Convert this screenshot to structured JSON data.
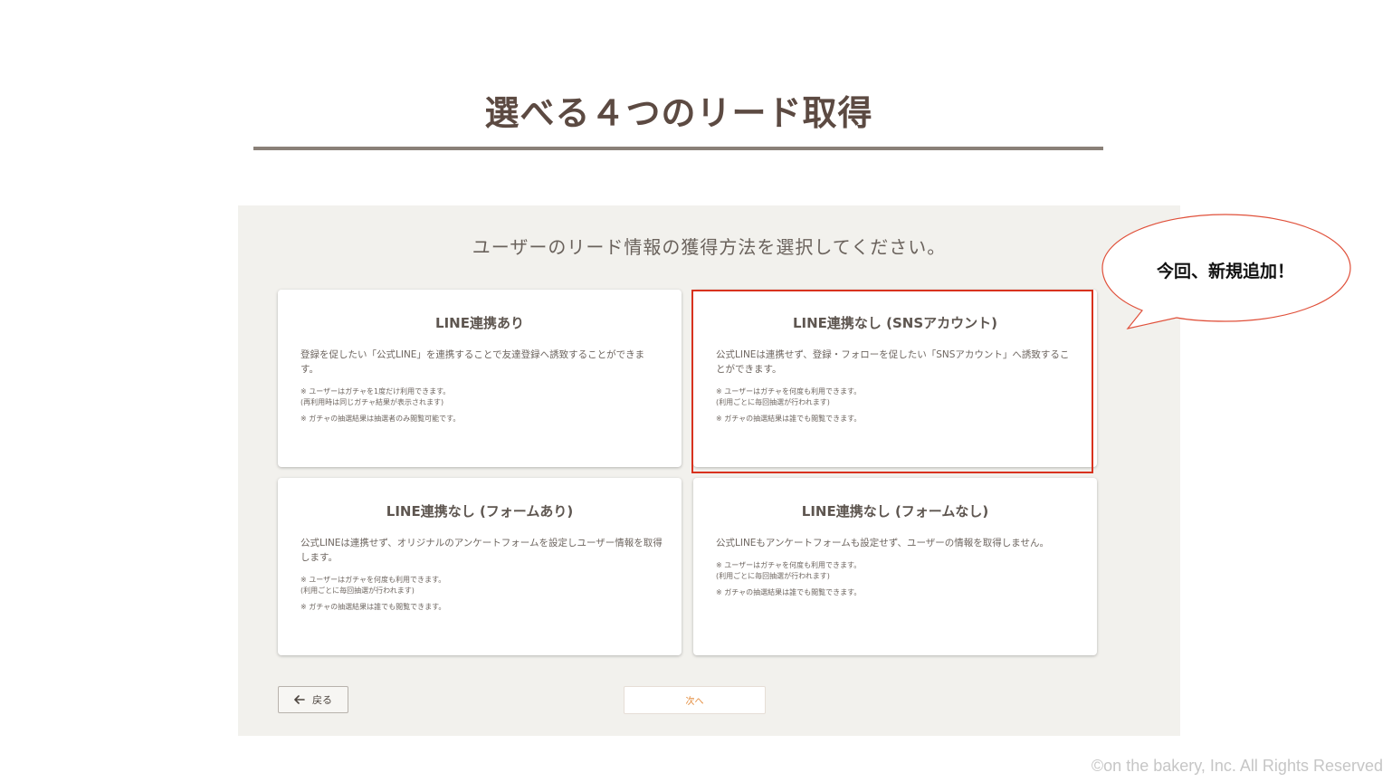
{
  "slide": {
    "title": "選べる４つのリード取得",
    "copyright": "©on the bakery, Inc. All Rights Reserved"
  },
  "panel": {
    "prompt": "ユーザーのリード情報の獲得方法を選択してください。",
    "cards": [
      {
        "title": "LINE連携あり",
        "description": "登録を促したい「公式LINE」を連携することで友達登録へ誘致することができます。",
        "notes": [
          "※ ユーザーはガチャを1度だけ利用できます。",
          "(再利用時は同じガチャ結果が表示されます)",
          "※ ガチャの抽選結果は抽選者のみ閲覧可能です。"
        ]
      },
      {
        "title": "LINE連携なし (SNSアカウント)",
        "description": "公式LINEは連携せず、登録・フォローを促したい「SNSアカウント」へ誘致することができます。",
        "notes": [
          "※ ユーザーはガチャを何度も利用できます。",
          "(利用ごとに毎回抽選が行われます)",
          "※ ガチャの抽選結果は誰でも閲覧できます。"
        ]
      },
      {
        "title": "LINE連携なし (フォームあり)",
        "description": "公式LINEは連携せず、オリジナルのアンケートフォームを設定しユーザー情報を取得します。",
        "notes": [
          "※ ユーザーはガチャを何度も利用できます。",
          "(利用ごとに毎回抽選が行われます)",
          "※ ガチャの抽選結果は誰でも閲覧できます。"
        ]
      },
      {
        "title": "LINE連携なし (フォームなし)",
        "description": "公式LINEもアンケートフォームも設定せず、ユーザーの情報を取得しません。",
        "notes": [
          "※ ユーザーはガチャを何度も利用できます。",
          "(利用ごとに毎回抽選が行われます)",
          "※ ガチャの抽選結果は誰でも閲覧できます。"
        ]
      }
    ],
    "back_label": "戻る",
    "next_label": "次へ"
  },
  "callout": {
    "text": "今回、新規追加！"
  },
  "colors": {
    "title": "#5c4a42",
    "panel_bg": "#f2f1ed",
    "highlight": "#d8321e",
    "next_text": "#e38a3a"
  },
  "icons": {
    "back": "arrow-left-icon"
  }
}
